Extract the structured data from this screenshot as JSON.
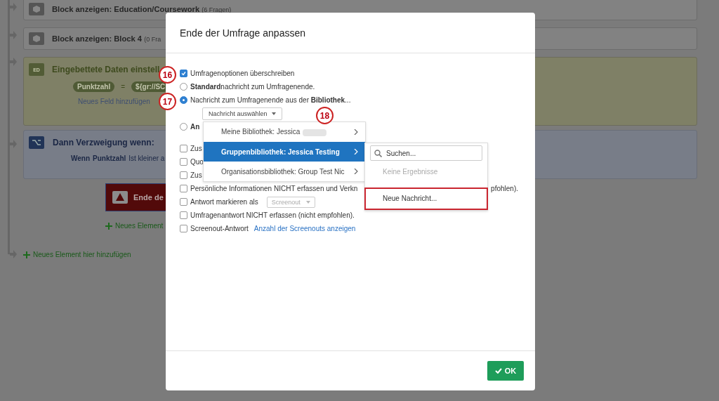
{
  "flow": [
    {
      "kind": "block",
      "title": "Block anzeigen: Education/Coursework",
      "note": "(6 Fragen)"
    },
    {
      "kind": "block",
      "title": "Block anzeigen: Block 4",
      "note": "(0 Fra"
    },
    {
      "kind": "embedded",
      "title": "Eingebettete Daten einstell",
      "badge": "ED",
      "field": "Punktzahl",
      "equals": "=",
      "value": "${gr://SC",
      "link": "Neues Feld hinzufügen"
    },
    {
      "kind": "branch",
      "title": "Dann Verzweigung wenn:",
      "cond": [
        "Wenn",
        "Punktzahl",
        "Ist kleiner a"
      ],
      "end": "Ende de",
      "add": "Neues Element"
    },
    {
      "kind": "add",
      "title": "Neues Element hier hinzufügen"
    }
  ],
  "modal": {
    "title": "Ende der Umfrage anpassen",
    "options": [
      {
        "kind": "checkbox",
        "text": "Umfragenoptionen überschreiben",
        "checked": true,
        "callout": "16"
      },
      {
        "kind": "radio",
        "text": "**Standard**nachricht zum Umfragenende.",
        "selected": false
      },
      {
        "kind": "radio",
        "text": "Nachricht zum Umfragenende aus der **Bibliothek**...",
        "selected": true,
        "callout": "17"
      },
      {
        "kind": "dropdown",
        "text": "Nachricht auswählen",
        "callout": "18"
      },
      {
        "kind": "radio",
        "text": "**An**",
        "selected": false
      },
      {
        "kind": "checkbox",
        "text": "Zus",
        "checked": false
      },
      {
        "kind": "checkbox",
        "text": "Quo",
        "checked": false
      },
      {
        "kind": "checkbox",
        "text": "Zus",
        "checked": false
      },
      {
        "kind": "checkbox",
        "text": "Persönliche Informationen NICHT erfassen und Verkn",
        "tail": "pfohlen).",
        "checked": false
      },
      {
        "kind": "checkbox",
        "text": "Antwort markieren als",
        "select": "Screenout",
        "checked": false
      },
      {
        "kind": "checkbox",
        "text": "Umfragenantwort NICHT erfassen (nicht empfohlen).",
        "checked": false
      },
      {
        "kind": "checkbox",
        "text": "Screenout-Antwort",
        "link": "Anzahl der Screenouts anzeigen",
        "checked": false
      }
    ],
    "menu": [
      {
        "label": "Meine Bibliothek: Jessica",
        "selected": false,
        "redacted": true
      },
      {
        "label": "Gruppenbibliothek: Jessica Testing",
        "selected": true
      },
      {
        "label": "Organisationsbibliothek: Group Test Nic",
        "selected": false
      }
    ],
    "submenu": {
      "placeholder": "Suchen...",
      "empty": "Keine Ergebnisse",
      "item": "Neue Nachricht...",
      "highlighted": true
    },
    "ok": "OK"
  }
}
